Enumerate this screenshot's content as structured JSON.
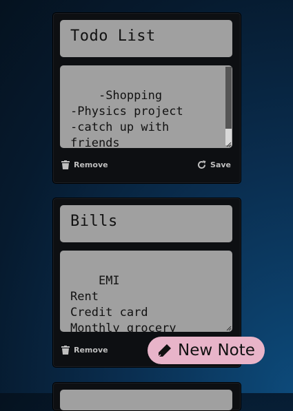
{
  "notes": [
    {
      "title": "Todo List",
      "body": "-Shopping\n-Physics project\n-catch up with friends\n-",
      "remove_label": "Remove",
      "save_label": "Save"
    },
    {
      "title": "Bills",
      "body": "EMI\nRent\nCredit card\nMonthly grocery",
      "remove_label": "Remove"
    }
  ],
  "new_note_label": "New Note",
  "colors": {
    "card": "#0d0f12",
    "field": "#a0a0a0",
    "action_text": "#bfbfbf",
    "new_note_button": "#e8b4c9"
  },
  "icons": [
    "trash-icon",
    "refresh-icon",
    "pencil-icon"
  ]
}
